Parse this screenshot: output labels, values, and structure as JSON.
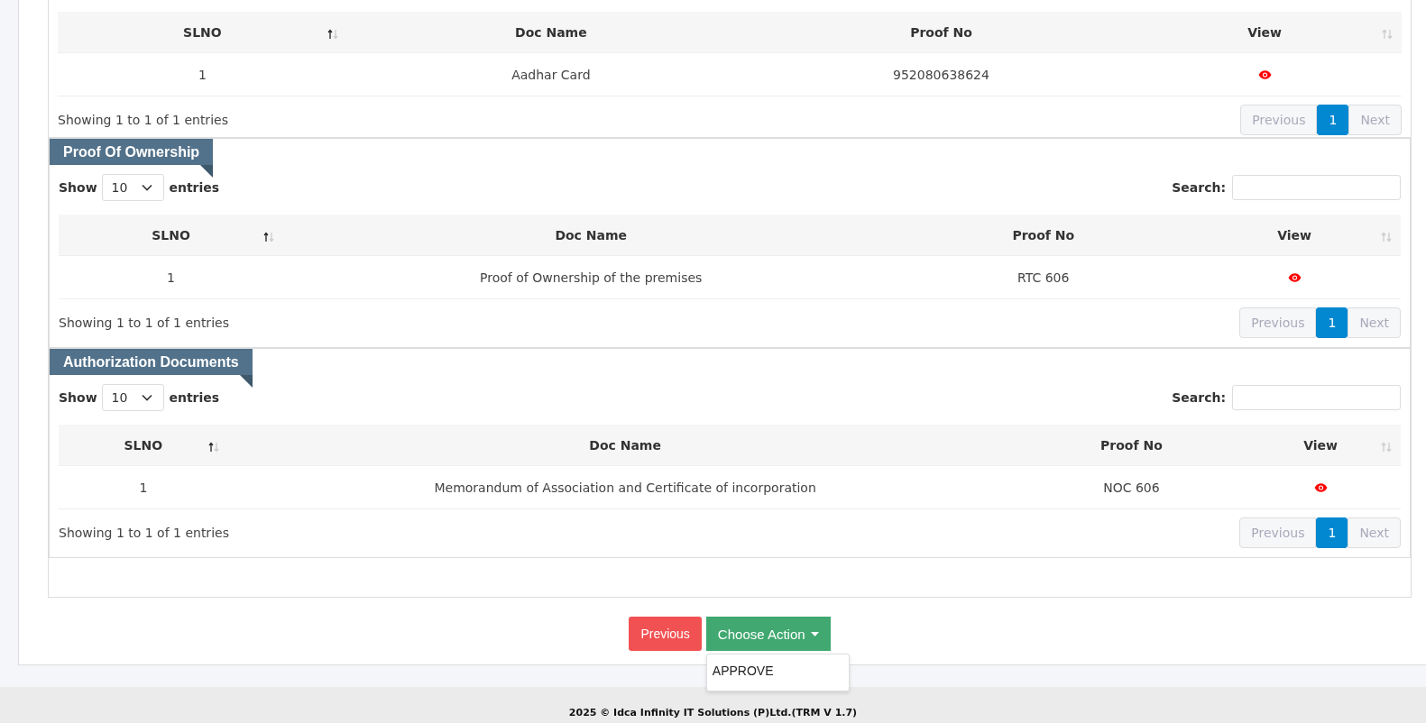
{
  "sections": [
    {
      "columns": [
        {
          "label": "SLNO",
          "sortable": true,
          "sorted": true
        },
        {
          "label": "Doc Name",
          "sortable": false
        },
        {
          "label": "Proof No",
          "sortable": false
        },
        {
          "label": "View",
          "sortable": true,
          "sorted": false
        }
      ],
      "rows": [
        {
          "slno": "1",
          "doc_name": "Aadhar Card",
          "proof_no": "952080638624"
        }
      ],
      "info": "Showing 1 to 1 of 1 entries",
      "pagination": {
        "previous": "Previous",
        "pages": [
          {
            "label": "1",
            "selected": true
          }
        ],
        "next": "Next"
      }
    },
    {
      "title": "Proof Of Ownership",
      "show_label": "Show",
      "page_size": "10",
      "entries_label": "entries",
      "search_label": "Search:",
      "columns": [
        {
          "label": "SLNO",
          "sortable": true,
          "sorted": true
        },
        {
          "label": "Doc Name",
          "sortable": false
        },
        {
          "label": "Proof No",
          "sortable": false
        },
        {
          "label": "View",
          "sortable": true,
          "sorted": false
        }
      ],
      "rows": [
        {
          "slno": "1",
          "doc_name": "Proof of Ownership of the premises",
          "proof_no": "RTC 606"
        }
      ],
      "info": "Showing 1 to 1 of 1 entries",
      "pagination": {
        "previous": "Previous",
        "pages": [
          {
            "label": "1",
            "selected": true
          }
        ],
        "next": "Next"
      }
    },
    {
      "title": "Authorization Documents",
      "show_label": "Show",
      "page_size": "10",
      "entries_label": "entries",
      "search_label": "Search:",
      "columns": [
        {
          "label": "SLNO",
          "sortable": true,
          "sorted": true
        },
        {
          "label": "Doc Name",
          "sortable": false
        },
        {
          "label": "Proof No",
          "sortable": false
        },
        {
          "label": "View",
          "sortable": true,
          "sorted": false
        }
      ],
      "rows": [
        {
          "slno": "1",
          "doc_name": "Memorandum of Association and Certificate of incorporation",
          "proof_no": "NOC 606"
        }
      ],
      "info": "Showing 1 to 1 of 1 entries",
      "pagination": {
        "previous": "Previous",
        "pages": [
          {
            "label": "1",
            "selected": true
          }
        ],
        "next": "Next"
      }
    }
  ],
  "actions": {
    "previous": "Previous",
    "choose_action": "Choose Action",
    "menu_items": [
      "APPROVE"
    ]
  },
  "footer": "2025 © Idca Infinity IT Solutions (P)Ltd.(TRM V 1.7)"
}
